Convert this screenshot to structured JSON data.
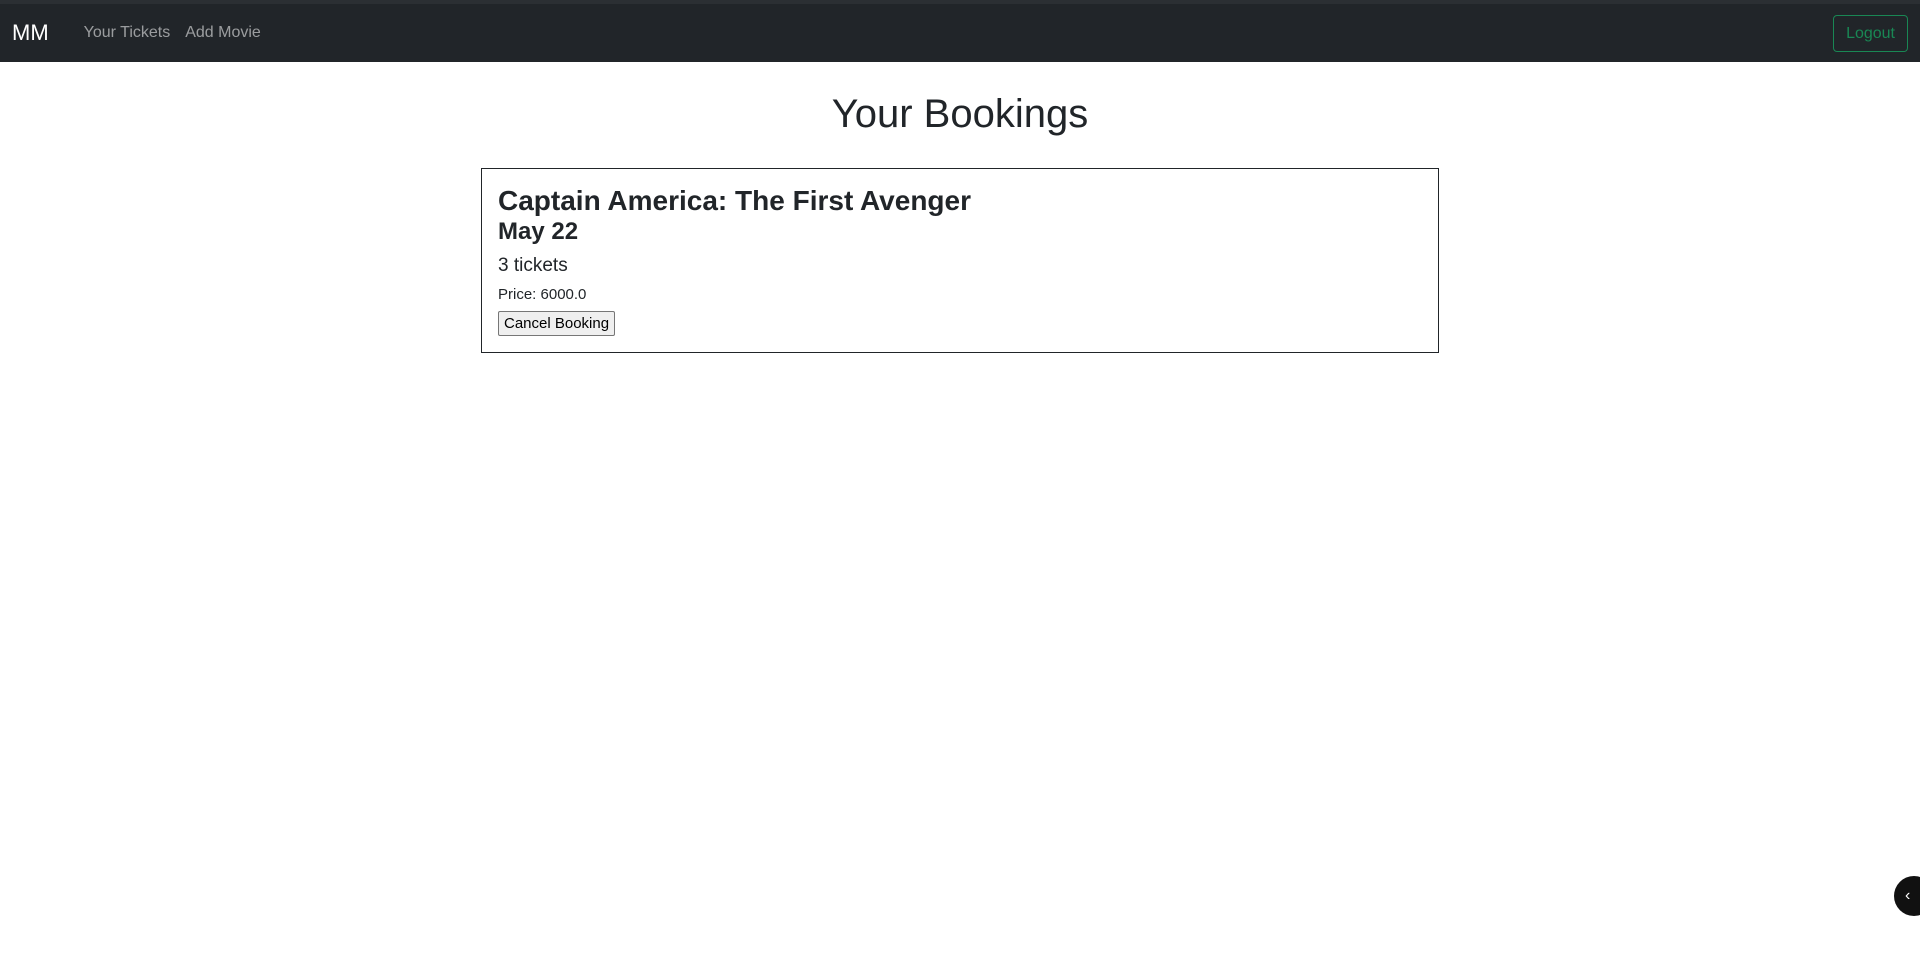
{
  "navbar": {
    "brand": "MM",
    "links": [
      {
        "label": "Your Tickets"
      },
      {
        "label": "Add Movie"
      }
    ],
    "logout_label": "Logout"
  },
  "page": {
    "title": "Your Bookings"
  },
  "bookings": [
    {
      "movie_title": "Captain America: The First Avenger",
      "date": "May 22",
      "tickets": "3 tickets",
      "price": "Price: 6000.0",
      "cancel_label": "Cancel Booking"
    }
  ],
  "floating_toggle": {
    "icon": "chevron-left-icon",
    "glyph": "‹"
  },
  "colors": {
    "navbar_bg": "#212529",
    "logout_accent": "#198754",
    "text": "#212529"
  }
}
